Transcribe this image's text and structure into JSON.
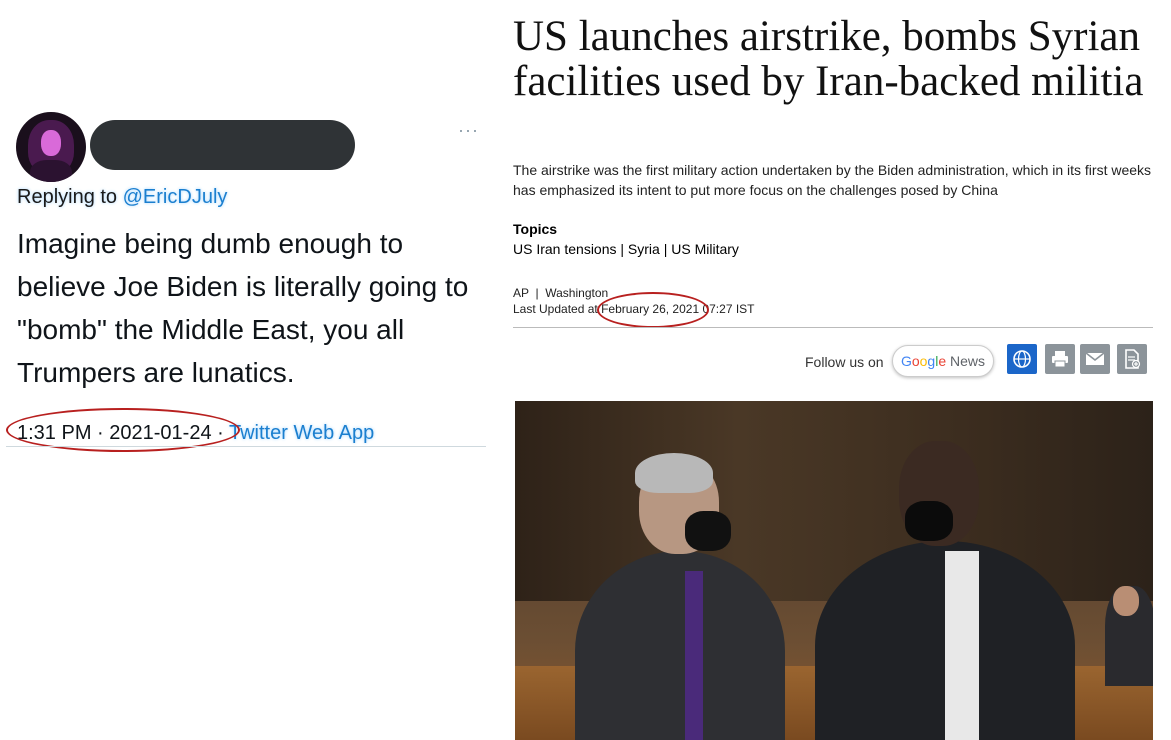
{
  "tweet": {
    "replying_prefix": "Replying to ",
    "replying_handle": "@EricDJuly",
    "text": "Imagine being dumb enough to believe Joe Biden is literally going to \"bomb\" the Middle East, you all Trumpers are lunatics.",
    "time_date": "1:31 PM · 2021-01-24 · ",
    "app": "Twitter Web App",
    "more_icon": "···"
  },
  "article": {
    "headline": "US launches airstrike, bombs Syrian facilities used by Iran-backed militia",
    "subhead": "The airstrike was the first military action undertaken by the Biden administration, which in its first weeks has emphasized its intent to put more focus on the challenges posed by China",
    "topics_label": "Topics",
    "topics": [
      "US Iran tensions",
      "Syria",
      "US Military"
    ],
    "topic_sep": " | ",
    "source": "AP",
    "byline_sep": "  |  ",
    "location": "Washington",
    "updated_prefix": "Last Updated at ",
    "updated": "February 26, 2021 07:27 IST",
    "follow_label": "Follow us on",
    "google_news": {
      "g1": "G",
      "g2": "o",
      "g3": "o",
      "g4": "g",
      "g5": "l",
      "g6": "e",
      "news": " News"
    },
    "share_icons": [
      "globe-icon",
      "print-icon",
      "mail-icon",
      "document-icon"
    ]
  },
  "colors": {
    "annotation_circle": "#b8201f",
    "link": "#1b7fcf",
    "globe_button": "#1b66c9",
    "share_button": "#8c949a"
  }
}
